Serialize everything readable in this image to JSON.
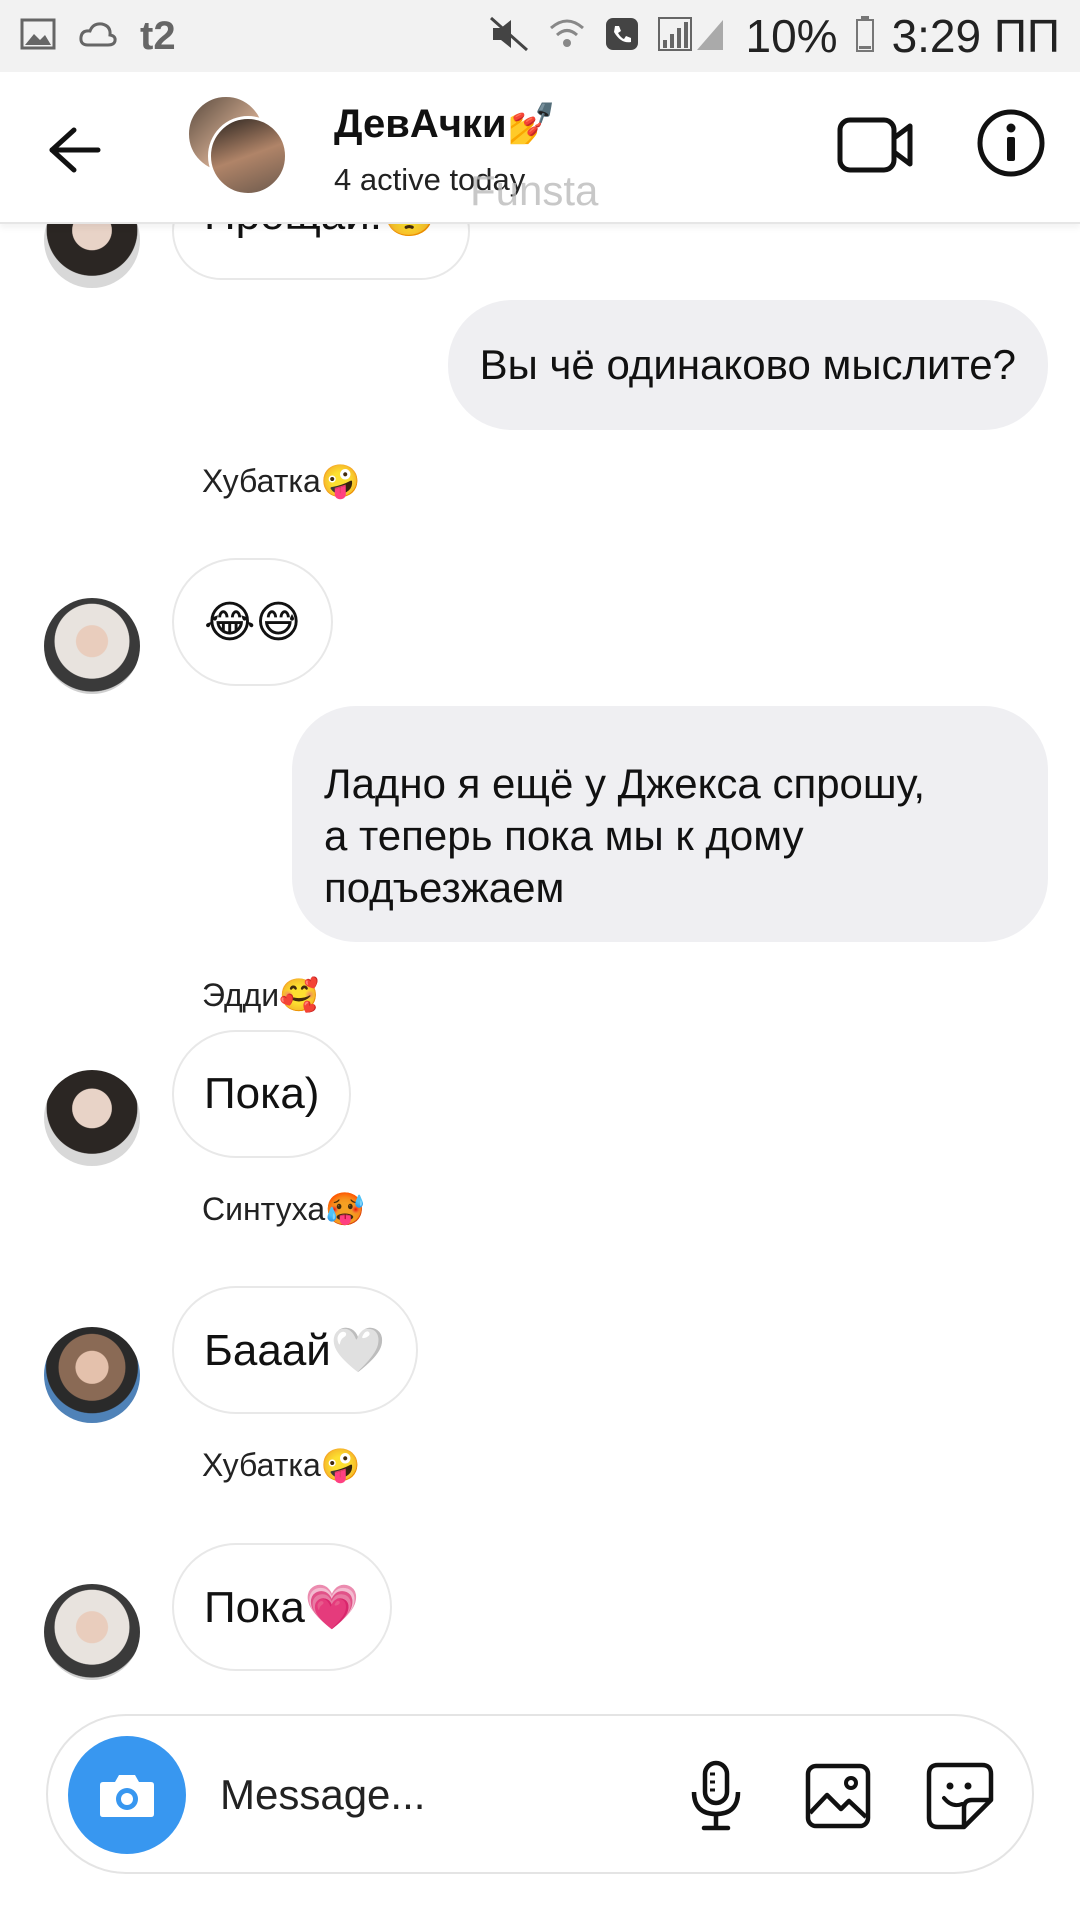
{
  "status_bar": {
    "carrier": "t2",
    "battery": "10%",
    "time": "3:29 ПП"
  },
  "header": {
    "title": "ДевАчки💅",
    "subtitle": "4 active today",
    "watermark": "Funsta"
  },
  "messages": {
    "top_partial": "Прощай!🥺",
    "m1": "Вы чё одинаково мыслите?",
    "s1": "Хубатка🤪",
    "m2": "😂😅",
    "m3_l1": "Ладно я ещё у Джекса спрошу,",
    "m3_l2": "а теперь пока мы к дому",
    "m3_l3": "подъезжаем",
    "s2": "Эдди🥰",
    "m4": "Пока)",
    "s3": "Синтуха🥵",
    "m5": "Бааай🤍",
    "s4": "Хубатка🤪",
    "m6": "Пока💗"
  },
  "composer": {
    "placeholder": "Message..."
  },
  "icons": [
    "back-arrow-icon",
    "video-camera-icon",
    "info-icon",
    "camera-icon",
    "microphone-icon",
    "image-icon",
    "sticker-icon"
  ]
}
